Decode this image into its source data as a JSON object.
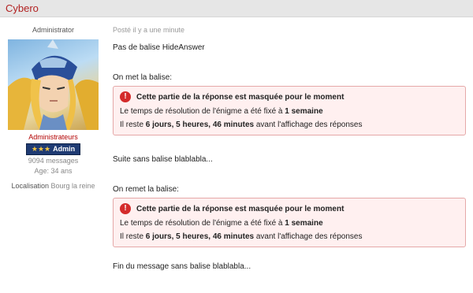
{
  "header": {
    "author": "Cybero"
  },
  "sidebar": {
    "role": "Administrator",
    "group": "Administrateurs",
    "badge": "Admin",
    "badge_stars": "★★★",
    "messages": "9094 messages",
    "age": "Age: 34 ans",
    "location_label": "Localisation",
    "location_value": "Bourg la reine"
  },
  "post": {
    "timestamp": "Posté il y a une minute",
    "intro": "Pas de balise HideAnswer",
    "label1": "On met la balise:",
    "hidden1": {
      "title": "Cette partie de la réponse est masquée pour le moment",
      "line1_pre": "Le temps de résolution de l'énigme a été fixé à",
      "line1_bold": "1 semaine",
      "line2_pre": "Il reste",
      "line2_bold": "6 jours, 5 heures, 46 minutes",
      "line2_post": "avant l'affichage des réponses"
    },
    "between": "Suite sans balise blablabla...",
    "label2": "On remet la balise:",
    "hidden2": {
      "title": "Cette partie de la réponse est masquée pour le moment",
      "line1_pre": "Le temps de résolution de l'énigme a été fixé à",
      "line1_bold": "1 semaine",
      "line2_pre": "Il reste",
      "line2_bold": "6 jours, 5 heures, 46 minutes",
      "line2_post": "avant l'affichage des réponses"
    },
    "end": "Fin du message sans balise blablabla..."
  },
  "colors": {
    "accent": "#b22222",
    "badge": "#1f3b73",
    "alert_bg": "#fff0f0",
    "alert_border": "#e5a8a8",
    "alert_icon": "#d42b2b"
  },
  "icons": {
    "alert": "exclamation-circle-icon",
    "stars": "star-icon"
  }
}
